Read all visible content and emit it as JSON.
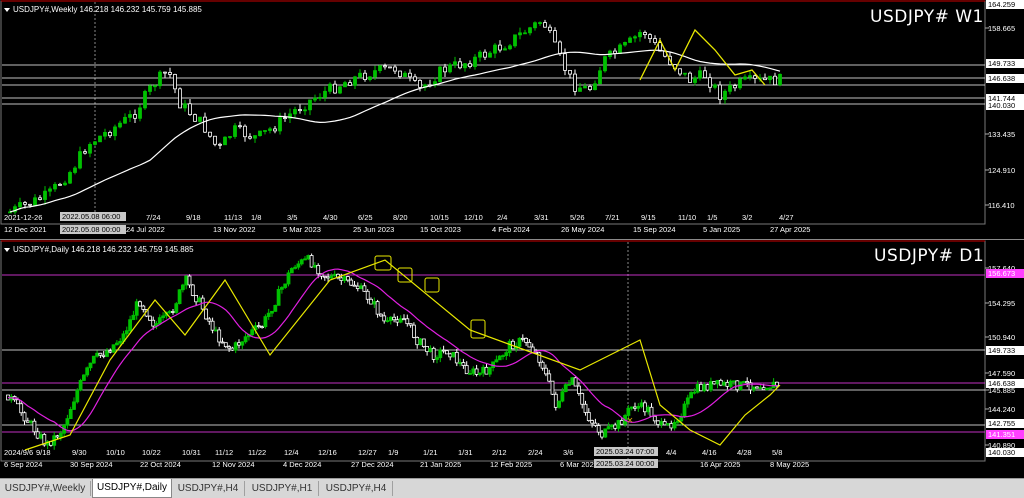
{
  "weekly": {
    "title": "USDJPY# W1",
    "info": "USDJPY#,Weekly  146.218 146.232 145.759 145.885",
    "time_labels": [
      "12 Dec 2021",
      "2022.05.08 06:00",
      "7/24",
      "9/18",
      "11/13",
      "1/8",
      "3/5",
      "4/30",
      "6/25",
      "8/20",
      "10/15",
      "12/10",
      "2/4",
      "3/31",
      "5/26",
      "7/21",
      "9/15",
      "11/10",
      "1/5",
      "3/2",
      "4/27"
    ],
    "date_labels": [
      "12 Dec 2021",
      "2022.05.08 00:00",
      "24 Jul 2022",
      "13 Nov 2022",
      "5 Mar 2023",
      "25 Jun 2023",
      "15 Oct 2023",
      "4 Feb 2024",
      "26 May 2024",
      "15 Sep 2024",
      "5 Jan 2025",
      "27 Apr 2025"
    ],
    "price_labels": [
      "164.259",
      "158.665",
      "149.733",
      "146.638",
      "141.744",
      "140.030",
      "133.435",
      "124.910",
      "116.410"
    ],
    "corner_label": "2021-12-26"
  },
  "daily": {
    "title": "USDJPY# D1",
    "info": "USDJPY#,Daily  146.218 146.232 145.759 145.885",
    "top_labels": [
      "9/18",
      "9/30",
      "10/10",
      "10/22",
      "10/31",
      "11/12",
      "11/22",
      "12/4",
      "12/16",
      "12/27",
      "1/9",
      "1/21",
      "1/31",
      "2/12",
      "2/24",
      "3/6",
      "3/18",
      "4/4",
      "4/16",
      "4/28",
      "5/8"
    ],
    "corner_label": "2024/9/6",
    "cursor_label": "2025.03.24 07:00",
    "date_labels": [
      "6 Sep 2024",
      "30 Sep 2024",
      "22 Oct 2024",
      "12 Nov 2024",
      "4 Dec 2024",
      "27 Dec 2024",
      "21 Jan 2025",
      "12 Feb 2025",
      "6 Mar 202",
      "2025.03.24 00:00",
      "16 Apr 2025",
      "8 May 2025"
    ],
    "price_labels": [
      "157.640",
      "156.673",
      "154.295",
      "150.940",
      "149.733",
      "147.590",
      "146.638",
      "145.885",
      "144.240",
      "142.755",
      "141.351",
      "140.890",
      "140.030"
    ]
  },
  "tabs": [
    "USDJPY#,Weekly",
    "USDJPY#,Daily",
    "USDJPY#,H4",
    "USDJPY#,H1",
    "USDJPY#,H4"
  ],
  "active_tab": 1,
  "colors": {
    "bull": "#00c000",
    "bear": "#ffffff",
    "ma_weekly": "#ffffff",
    "ma_daily": "#e020e0",
    "zigzag": "#e8e800",
    "magenta_line": "#ff40ff"
  }
}
